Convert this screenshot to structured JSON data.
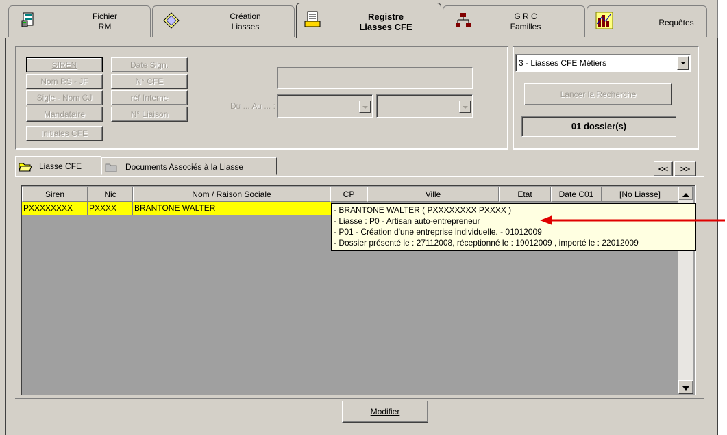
{
  "tabs": [
    {
      "label": "Fichier\nRM",
      "icon": "database-icon"
    },
    {
      "label": "Création\nLiasses",
      "icon": "diamond-folder-icon"
    },
    {
      "label": "Registre\nLiasses CFE",
      "icon": "register-icon",
      "active": true
    },
    {
      "label": "G R C\nFamilles",
      "icon": "org-chart-icon"
    },
    {
      "label": "Requêtes",
      "icon": "bar-chart-icon"
    }
  ],
  "search_buttons": {
    "siren": "SIREN",
    "date_sign": "Date Sign.",
    "nom_rs": "Nom RS - JF",
    "no_cfe": "N° CFE",
    "sigle": "Sigle - Nom CJ",
    "ref_interne": "réf Interne",
    "mandataire": "Mandataire",
    "no_liaison": "N° Liaison",
    "initiales": "Initiales CFE"
  },
  "date_range_label": "Du ... Au ... :",
  "query_select": "3 - Liasses CFE Métiers",
  "launch_button": "Lancer la Recherche",
  "result_count": "01 dossier(s)",
  "subtabs": {
    "liasse": "Liasse CFE",
    "documents": "Documents Associés à la Liasse"
  },
  "nav": {
    "prev": "<<",
    "next": ">>"
  },
  "grid": {
    "headers": [
      "Siren",
      "Nic",
      "Nom / Raison Sociale",
      "CP",
      "Ville",
      "Etat",
      "Date C01",
      "[No Liasse]"
    ],
    "rows": [
      {
        "siren": "PXXXXXXXX",
        "nic": "PXXXX",
        "nom": "BRANTONE WALTER"
      }
    ]
  },
  "tooltip_lines": [
    "- BRANTONE WALTER ( PXXXXXXXX PXXXX )",
    "- Liasse : P0 - Artisan auto-entrepreneur",
    "- P01 - Création d'une entreprise individuelle. - 01012009",
    "- Dossier présenté le : 27112008, réceptionné le : 19012009 , importé le : 22012009"
  ],
  "modify_button": "Modifier",
  "colors": {
    "highlight": "#ffff00",
    "tooltip": "#ffffe1",
    "arrow": "#e00000"
  }
}
